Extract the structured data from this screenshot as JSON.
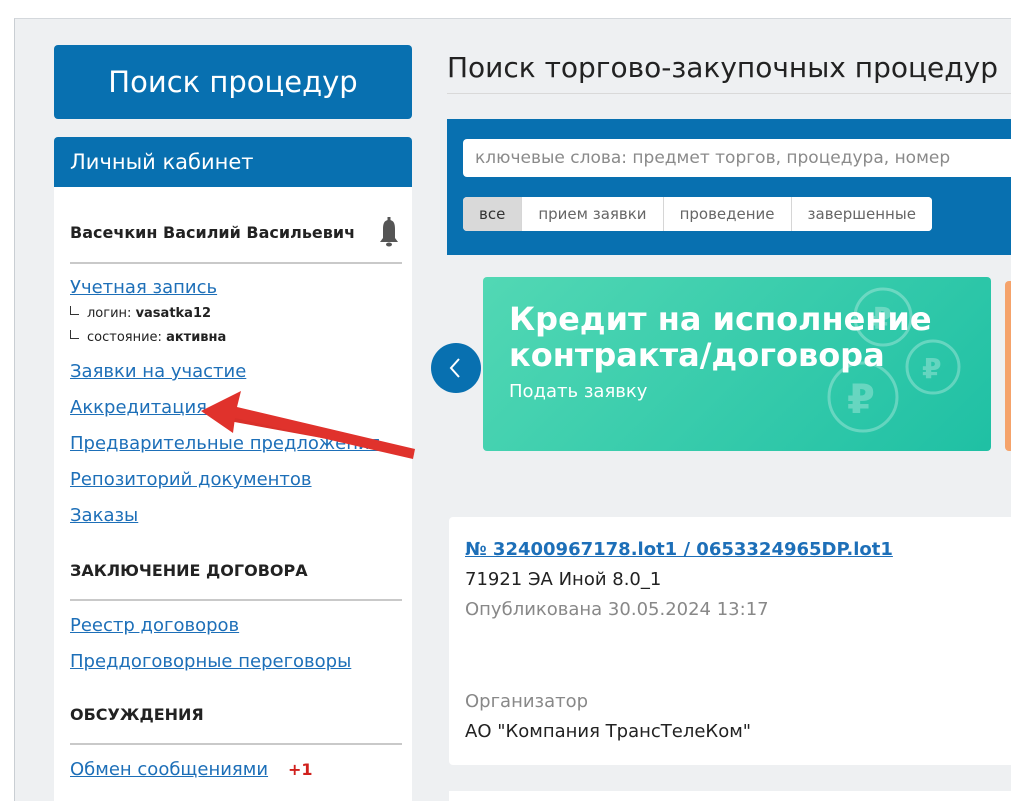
{
  "sidebar": {
    "search_button": "Поиск процедур",
    "cabinet_title": "Личный кабинет",
    "user_name": "Васечкин Василий Васильевич",
    "account": {
      "link": "Учетная запись",
      "login_label": "логин:",
      "login_value": "vasatka12",
      "status_label": "состояние:",
      "status_value": "активна"
    },
    "links": [
      "Заявки на участие",
      "Аккредитация",
      "Предварительные предложения",
      "Репозиторий документов",
      "Заказы"
    ],
    "contract_section": {
      "title": "ЗАКЛЮЧЕНИЕ ДОГОВОРА",
      "links": [
        "Реестр договоров",
        "Преддоговорные переговоры"
      ]
    },
    "discussion_section": {
      "title": "ОБСУЖДЕНИЯ",
      "messages_link": "Обмен сообщениями",
      "messages_badge": "+1"
    }
  },
  "main": {
    "title": "Поиск торгово-закупочных процедур",
    "search": {
      "placeholder": "ключевые слова: предмет торгов, процедура, номер"
    },
    "filters": [
      "все",
      "прием заявки",
      "проведение",
      "завершенные"
    ],
    "active_filter": "все",
    "banner": {
      "title_line1": "Кредит на исполнение",
      "title_line2": "контракта/договора",
      "link": "Подать заявку"
    },
    "procedure": {
      "number": "№ 32400967178.lot1 / 0653324965DP.lot1",
      "name": "71921 ЭА Иной 8.0_1",
      "published": "Опубликована 30.05.2024 13:17",
      "organizer_label": "Организатор",
      "organizer": "АО \"Компания ТрансТелеКом\""
    }
  },
  "colors": {
    "brand_blue": "#0870b0",
    "link_blue": "#1d6fb8",
    "banner_green": "#2cc9a9",
    "arrow_red": "#e0322c",
    "badge_red": "#d0201c"
  },
  "icons": [
    "bell-icon",
    "chevron-left-icon",
    "ruble-coin-icon",
    "annotation-arrow"
  ]
}
